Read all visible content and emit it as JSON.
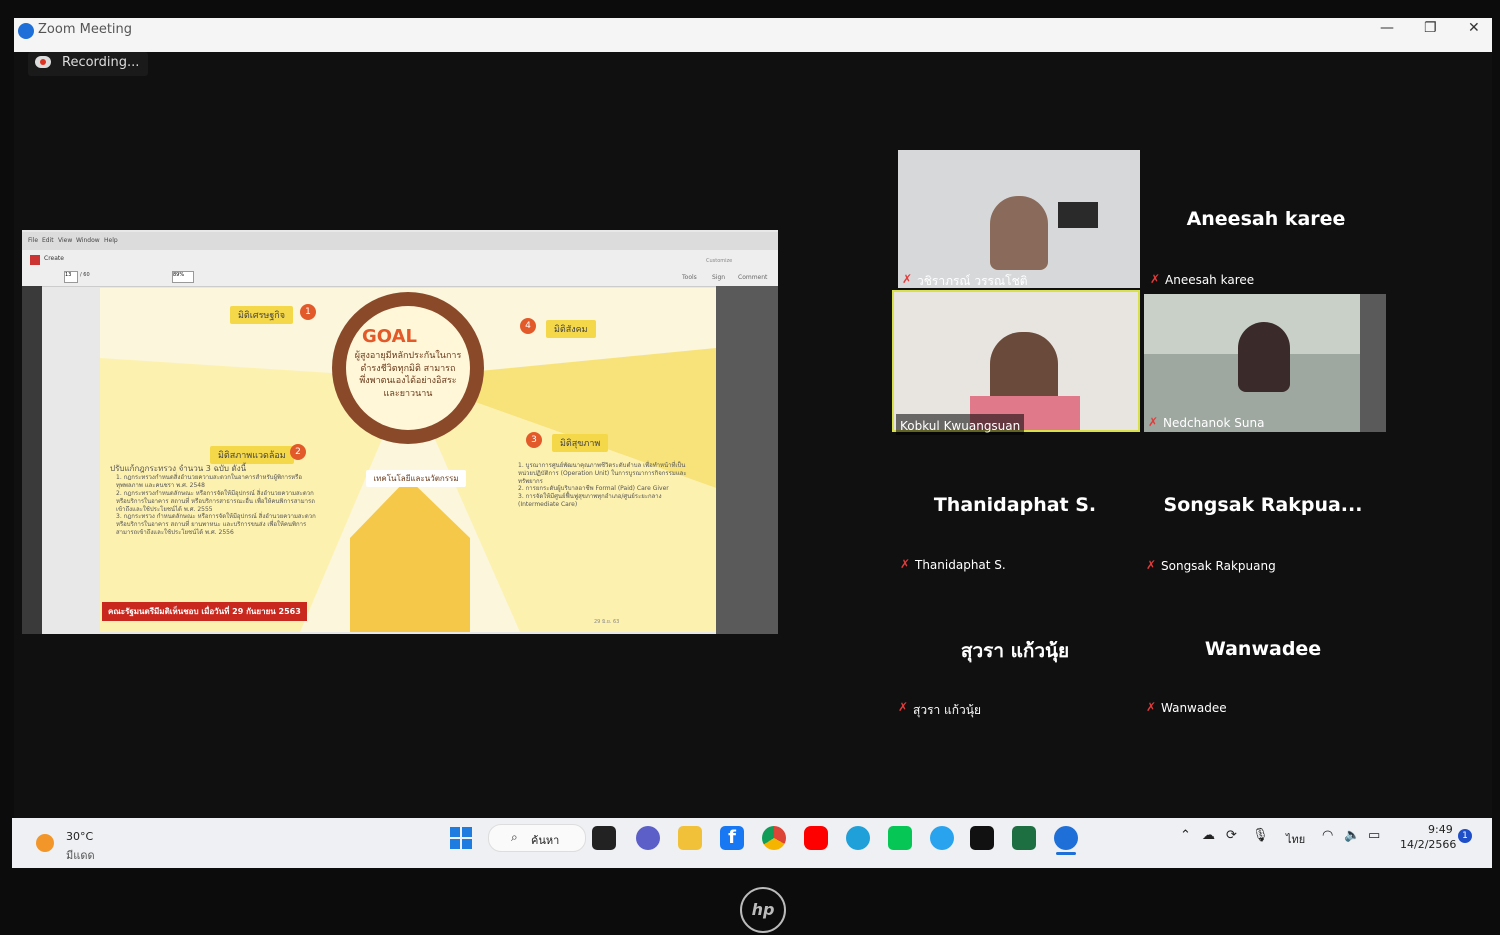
{
  "window": {
    "title": "Zoom Meeting",
    "minimize": "—",
    "maximize": "❐",
    "close": "✕"
  },
  "recording": {
    "label": "Recording..."
  },
  "share": {
    "menu": [
      "File",
      "Edit",
      "View",
      "Window",
      "Help"
    ],
    "toolbar": {
      "create": "Create",
      "page_current": "13",
      "page_total": "/ 60",
      "zoom": "89%",
      "customize": "Customize"
    },
    "tabs": [
      "Tools",
      "Sign",
      "Comment"
    ],
    "slide": {
      "goal_label": "GOAL",
      "goal_text": "ผู้สูงอายุมีหลักประกันในการดำรงชีวิตทุกมิติ สามารถพึ่งพาตนเองได้อย่างอิสระและยาวนาน",
      "sections": [
        {
          "num": "1",
          "title": "มิติเศรษฐกิจ"
        },
        {
          "num": "2",
          "title": "มิติสภาพแวดล้อม"
        },
        {
          "num": "3",
          "title": "มิติสุขภาพ"
        },
        {
          "num": "4",
          "title": "มิติสังคม"
        }
      ],
      "tech_title": "เทคโนโลยีและนวัตกรรม",
      "cabinet_banner": "คณะรัฐมนตรีมีมติเห็นชอบ เมื่อวันที่ 29 กันยายน 2563",
      "env_intro": "ปรับแก้กฎกระทรวง จำนวน 3 ฉบับ ดังนี้",
      "env_items": [
        "1. กฎกระทรวงกำหนดสิ่งอำนวยความสะดวกในอาคารสำหรับผู้พิการหรือทุพพลภาพ และคนชรา พ.ศ. 2548",
        "2. กฎกระทรวงกำหนดลักษณะ หรือการจัดให้มีอุปกรณ์ สิ่งอำนวยความสะดวก หรือบริการในอาคาร สถานที่ หรือบริการสาธารณะอื่น เพื่อให้คนพิการสามารถเข้าถึงและใช้ประโยชน์ได้ พ.ศ. 2555",
        "3. กฎกระทรวง กำหนดลักษณะ หรือการจัดให้มีอุปกรณ์ สิ่งอำนวยความสะดวก หรือบริการในอาคาร สถานที่ ยานพาหนะ และบริการขนส่ง เพื่อให้คนพิการสามารถเข้าถึงและใช้ประโยชน์ได้ พ.ศ. 2556"
      ],
      "health_items": [
        "1. บูรณาการศูนย์พัฒนาคุณภาพชีวิตระดับตำบล เพื่อทำหน้าที่เป็นหน่วยปฏิบัติการ (Operation Unit) ในการบูรณาการกิจกรรมและทรัพยากร",
        "2. การยกระดับผู้บริบาลอาชีพ Formal (Paid) Care Giver",
        "3. การจัดให้มีศูนย์ฟื้นฟูสุขภาพทุกอำเภอ/ศูนย์ระยะกลาง (Intermediate Care)"
      ],
      "footer_date": "29 มิ.ย. 63"
    }
  },
  "participants": {
    "tiles": [
      {
        "name": "วชิราภรณ์ วรรณโชติ",
        "type": "video"
      },
      {
        "name": "Aneesah karee",
        "type": "name"
      },
      {
        "name": "Kobkul Kwuangsuan",
        "type": "video",
        "active": true
      },
      {
        "name": "Nedchanok Suna",
        "type": "video"
      },
      {
        "name": "Thanidaphat S.",
        "type": "name"
      },
      {
        "name": "Songsak Rakpuang",
        "display": "Songsak  Rakpua...",
        "type": "name"
      },
      {
        "name": "สุวรา แก้วนุ้ย",
        "type": "name"
      },
      {
        "name": "Wanwadee",
        "type": "name"
      }
    ]
  },
  "taskbar": {
    "weather_temp": "30°C",
    "weather_desc": "มีแดด",
    "search_label": "ค้นหา",
    "language": "ไทย",
    "time": "9:49",
    "date": "14/2/2566",
    "notification_count": "1",
    "pinned_icons": [
      "start-icon",
      "search-icon",
      "task-view-icon",
      "teams-icon",
      "file-explorer-icon",
      "facebook-icon",
      "chrome-icon",
      "youtube-icon",
      "edge-icon",
      "line-icon",
      "zalo-icon",
      "webex-icon",
      "excel-icon",
      "zoom-icon"
    ]
  },
  "brand": {
    "laptop_logo": "hp"
  },
  "colors": {
    "zoom_blue": "#1f6fd8",
    "mic_muted": "#e23b3b",
    "active_speaker": "#d8e04a",
    "slide_accent": "#f5d84a",
    "slide_red": "#e25a2a"
  }
}
